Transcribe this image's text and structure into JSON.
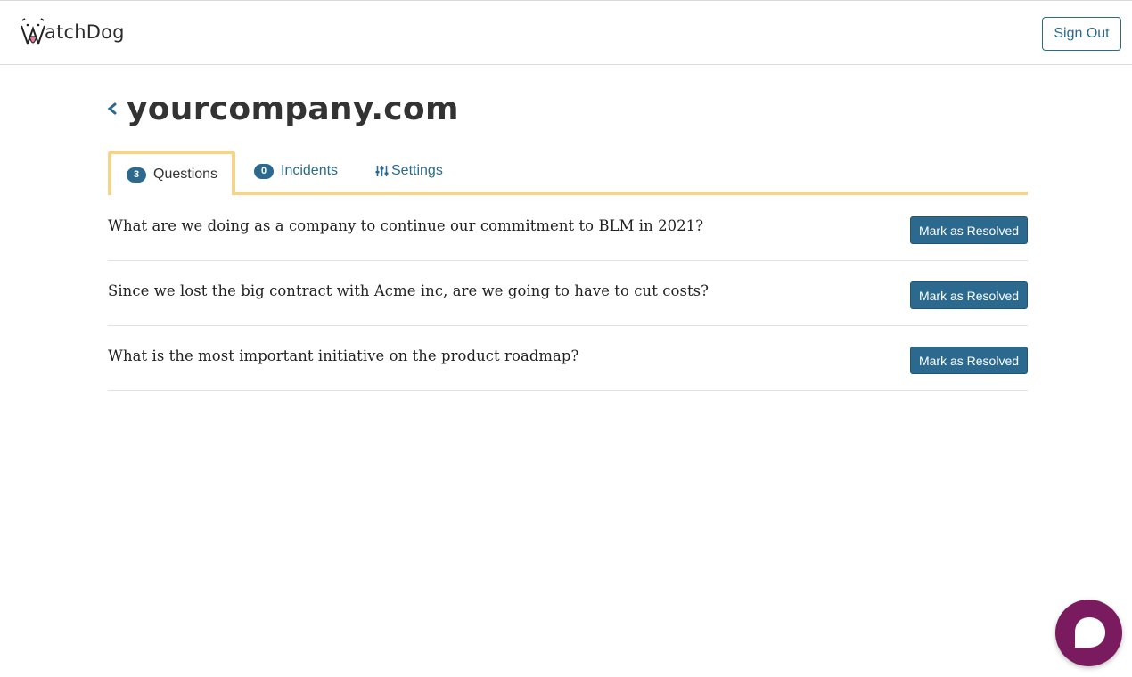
{
  "header": {
    "logo_text": "atchDog",
    "sign_out_label": "Sign Out"
  },
  "page": {
    "title": "yourcompany.com"
  },
  "tabs": [
    {
      "label": "Questions",
      "count": "3",
      "active": true
    },
    {
      "label": "Incidents",
      "count": "0",
      "active": false
    },
    {
      "label": "Settings",
      "icon": "sliders-icon",
      "active": false
    }
  ],
  "questions": [
    {
      "text": "What are we doing as a company to continue our commitment to BLM in 2021?",
      "action_label": "Mark as Resolved"
    },
    {
      "text": "Since we lost the big contract with Acme inc, are we going to have to cut costs?",
      "action_label": "Mark as Resolved"
    },
    {
      "text": "What is the most important initiative on the product roadmap?",
      "action_label": "Mark as Resolved"
    }
  ],
  "chat_widget": {
    "icon": "chat-bubble-icon"
  },
  "colors": {
    "accent": "#2b6a8e",
    "tab_border": "#f3d48a",
    "chat": "#7b1b5f",
    "logo_tongue": "#e07aa3"
  }
}
